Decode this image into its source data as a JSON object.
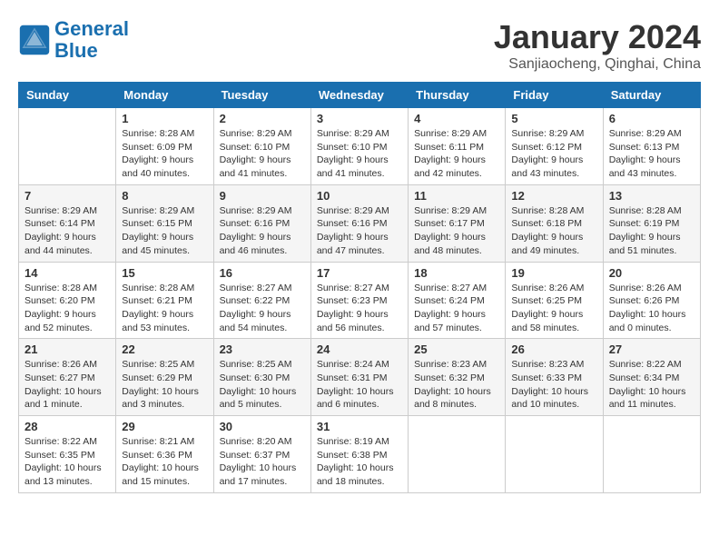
{
  "header": {
    "logo_line1": "General",
    "logo_line2": "Blue",
    "month": "January 2024",
    "location": "Sanjiaocheng, Qinghai, China"
  },
  "weekdays": [
    "Sunday",
    "Monday",
    "Tuesday",
    "Wednesday",
    "Thursday",
    "Friday",
    "Saturday"
  ],
  "weeks": [
    [
      {
        "day": null
      },
      {
        "day": "1",
        "sunrise": "Sunrise: 8:28 AM",
        "sunset": "Sunset: 6:09 PM",
        "daylight": "Daylight: 9 hours and 40 minutes."
      },
      {
        "day": "2",
        "sunrise": "Sunrise: 8:29 AM",
        "sunset": "Sunset: 6:10 PM",
        "daylight": "Daylight: 9 hours and 41 minutes."
      },
      {
        "day": "3",
        "sunrise": "Sunrise: 8:29 AM",
        "sunset": "Sunset: 6:10 PM",
        "daylight": "Daylight: 9 hours and 41 minutes."
      },
      {
        "day": "4",
        "sunrise": "Sunrise: 8:29 AM",
        "sunset": "Sunset: 6:11 PM",
        "daylight": "Daylight: 9 hours and 42 minutes."
      },
      {
        "day": "5",
        "sunrise": "Sunrise: 8:29 AM",
        "sunset": "Sunset: 6:12 PM",
        "daylight": "Daylight: 9 hours and 43 minutes."
      },
      {
        "day": "6",
        "sunrise": "Sunrise: 8:29 AM",
        "sunset": "Sunset: 6:13 PM",
        "daylight": "Daylight: 9 hours and 43 minutes."
      }
    ],
    [
      {
        "day": "7",
        "sunrise": "Sunrise: 8:29 AM",
        "sunset": "Sunset: 6:14 PM",
        "daylight": "Daylight: 9 hours and 44 minutes."
      },
      {
        "day": "8",
        "sunrise": "Sunrise: 8:29 AM",
        "sunset": "Sunset: 6:15 PM",
        "daylight": "Daylight: 9 hours and 45 minutes."
      },
      {
        "day": "9",
        "sunrise": "Sunrise: 8:29 AM",
        "sunset": "Sunset: 6:16 PM",
        "daylight": "Daylight: 9 hours and 46 minutes."
      },
      {
        "day": "10",
        "sunrise": "Sunrise: 8:29 AM",
        "sunset": "Sunset: 6:16 PM",
        "daylight": "Daylight: 9 hours and 47 minutes."
      },
      {
        "day": "11",
        "sunrise": "Sunrise: 8:29 AM",
        "sunset": "Sunset: 6:17 PM",
        "daylight": "Daylight: 9 hours and 48 minutes."
      },
      {
        "day": "12",
        "sunrise": "Sunrise: 8:28 AM",
        "sunset": "Sunset: 6:18 PM",
        "daylight": "Daylight: 9 hours and 49 minutes."
      },
      {
        "day": "13",
        "sunrise": "Sunrise: 8:28 AM",
        "sunset": "Sunset: 6:19 PM",
        "daylight": "Daylight: 9 hours and 51 minutes."
      }
    ],
    [
      {
        "day": "14",
        "sunrise": "Sunrise: 8:28 AM",
        "sunset": "Sunset: 6:20 PM",
        "daylight": "Daylight: 9 hours and 52 minutes."
      },
      {
        "day": "15",
        "sunrise": "Sunrise: 8:28 AM",
        "sunset": "Sunset: 6:21 PM",
        "daylight": "Daylight: 9 hours and 53 minutes."
      },
      {
        "day": "16",
        "sunrise": "Sunrise: 8:27 AM",
        "sunset": "Sunset: 6:22 PM",
        "daylight": "Daylight: 9 hours and 54 minutes."
      },
      {
        "day": "17",
        "sunrise": "Sunrise: 8:27 AM",
        "sunset": "Sunset: 6:23 PM",
        "daylight": "Daylight: 9 hours and 56 minutes."
      },
      {
        "day": "18",
        "sunrise": "Sunrise: 8:27 AM",
        "sunset": "Sunset: 6:24 PM",
        "daylight": "Daylight: 9 hours and 57 minutes."
      },
      {
        "day": "19",
        "sunrise": "Sunrise: 8:26 AM",
        "sunset": "Sunset: 6:25 PM",
        "daylight": "Daylight: 9 hours and 58 minutes."
      },
      {
        "day": "20",
        "sunrise": "Sunrise: 8:26 AM",
        "sunset": "Sunset: 6:26 PM",
        "daylight": "Daylight: 10 hours and 0 minutes."
      }
    ],
    [
      {
        "day": "21",
        "sunrise": "Sunrise: 8:26 AM",
        "sunset": "Sunset: 6:27 PM",
        "daylight": "Daylight: 10 hours and 1 minute."
      },
      {
        "day": "22",
        "sunrise": "Sunrise: 8:25 AM",
        "sunset": "Sunset: 6:29 PM",
        "daylight": "Daylight: 10 hours and 3 minutes."
      },
      {
        "day": "23",
        "sunrise": "Sunrise: 8:25 AM",
        "sunset": "Sunset: 6:30 PM",
        "daylight": "Daylight: 10 hours and 5 minutes."
      },
      {
        "day": "24",
        "sunrise": "Sunrise: 8:24 AM",
        "sunset": "Sunset: 6:31 PM",
        "daylight": "Daylight: 10 hours and 6 minutes."
      },
      {
        "day": "25",
        "sunrise": "Sunrise: 8:23 AM",
        "sunset": "Sunset: 6:32 PM",
        "daylight": "Daylight: 10 hours and 8 minutes."
      },
      {
        "day": "26",
        "sunrise": "Sunrise: 8:23 AM",
        "sunset": "Sunset: 6:33 PM",
        "daylight": "Daylight: 10 hours and 10 minutes."
      },
      {
        "day": "27",
        "sunrise": "Sunrise: 8:22 AM",
        "sunset": "Sunset: 6:34 PM",
        "daylight": "Daylight: 10 hours and 11 minutes."
      }
    ],
    [
      {
        "day": "28",
        "sunrise": "Sunrise: 8:22 AM",
        "sunset": "Sunset: 6:35 PM",
        "daylight": "Daylight: 10 hours and 13 minutes."
      },
      {
        "day": "29",
        "sunrise": "Sunrise: 8:21 AM",
        "sunset": "Sunset: 6:36 PM",
        "daylight": "Daylight: 10 hours and 15 minutes."
      },
      {
        "day": "30",
        "sunrise": "Sunrise: 8:20 AM",
        "sunset": "Sunset: 6:37 PM",
        "daylight": "Daylight: 10 hours and 17 minutes."
      },
      {
        "day": "31",
        "sunrise": "Sunrise: 8:19 AM",
        "sunset": "Sunset: 6:38 PM",
        "daylight": "Daylight: 10 hours and 18 minutes."
      },
      {
        "day": null
      },
      {
        "day": null
      },
      {
        "day": null
      }
    ]
  ]
}
